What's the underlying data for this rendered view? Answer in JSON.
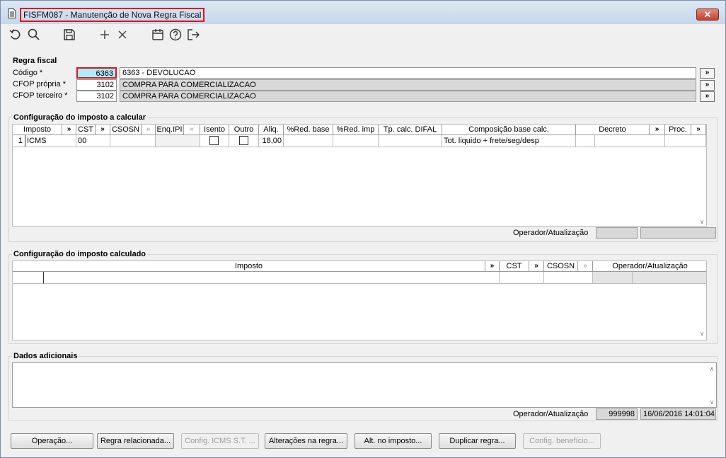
{
  "window": {
    "title": "FISFM087 - Manutenção de Nova Regra Fiscal",
    "close_label": "✕"
  },
  "toolbar": {
    "icons": [
      "undo-icon",
      "search-icon",
      "save-icon",
      "add-icon",
      "delete-icon",
      "calendar-icon",
      "help-icon",
      "exit-icon"
    ]
  },
  "regra_fiscal": {
    "title": "Regra fiscal",
    "codigo_label": "Código *",
    "codigo_value": "6363",
    "codigo_desc": "6363 - DEVOLUCAO",
    "cfop_propria_label": "CFOP própria *",
    "cfop_propria_value": "3102",
    "cfop_propria_desc": "COMPRA PARA COMERCIALIZACAO",
    "cfop_terceiro_label": "CFOP terceiro *",
    "cfop_terceiro_value": "3102",
    "cfop_terceiro_desc": "COMPRA PARA COMERCIALIZACAO",
    "lookup_label": "»"
  },
  "imposto_calcular": {
    "title": "Configuração do imposto a calcular",
    "headers": {
      "imposto": "Imposto",
      "cst": "CST",
      "csosn": "CSOSN",
      "enq_ipi": "Enq.IPI",
      "isento": "Isento",
      "outro": "Outro",
      "aliq": "Aliq.",
      "red_base": "%Red. base",
      "red_imp": "%Red. imp",
      "tp_calc": "Tp. calc. DIFAL",
      "composicao": "Composição base calc.",
      "decreto": "Decreto",
      "proc": "Proc.",
      "lookup": "»",
      "lookup_dis": "»"
    },
    "row": {
      "num": "1",
      "imposto": "ICMS",
      "cst": "00",
      "csosn": "",
      "enq_ipi": "",
      "aliq": "18,00",
      "red_base": "",
      "red_imp": "",
      "tp_calc": "",
      "composicao": "Tot. liquido + frete/seg/desp",
      "decreto": "",
      "proc": ""
    },
    "operador_label": "Operador/Atualização"
  },
  "imposto_calculado": {
    "title": "Configuração do imposto calculado",
    "headers": {
      "imposto": "Imposto",
      "cst": "CST",
      "csosn": "CSOSN",
      "operador": "Operador/Atualização",
      "lookup": "»"
    }
  },
  "dados_adicionais": {
    "title": "Dados adicionais",
    "operador_label": "Operador/Atualização",
    "operador_value": "999998",
    "atualizacao_value": "16/06/2016 14:01:04"
  },
  "buttons": {
    "operacao": "Operação...",
    "regra_relacionada": "Regra relacionada...",
    "config_icms_st": "Config. ICMS S.T. ...",
    "alteracoes": "Alterações na regra...",
    "alt_imposto": "Alt. no imposto...",
    "duplicar": "Duplicar regra...",
    "config_beneficio": "Config. benefício..."
  }
}
